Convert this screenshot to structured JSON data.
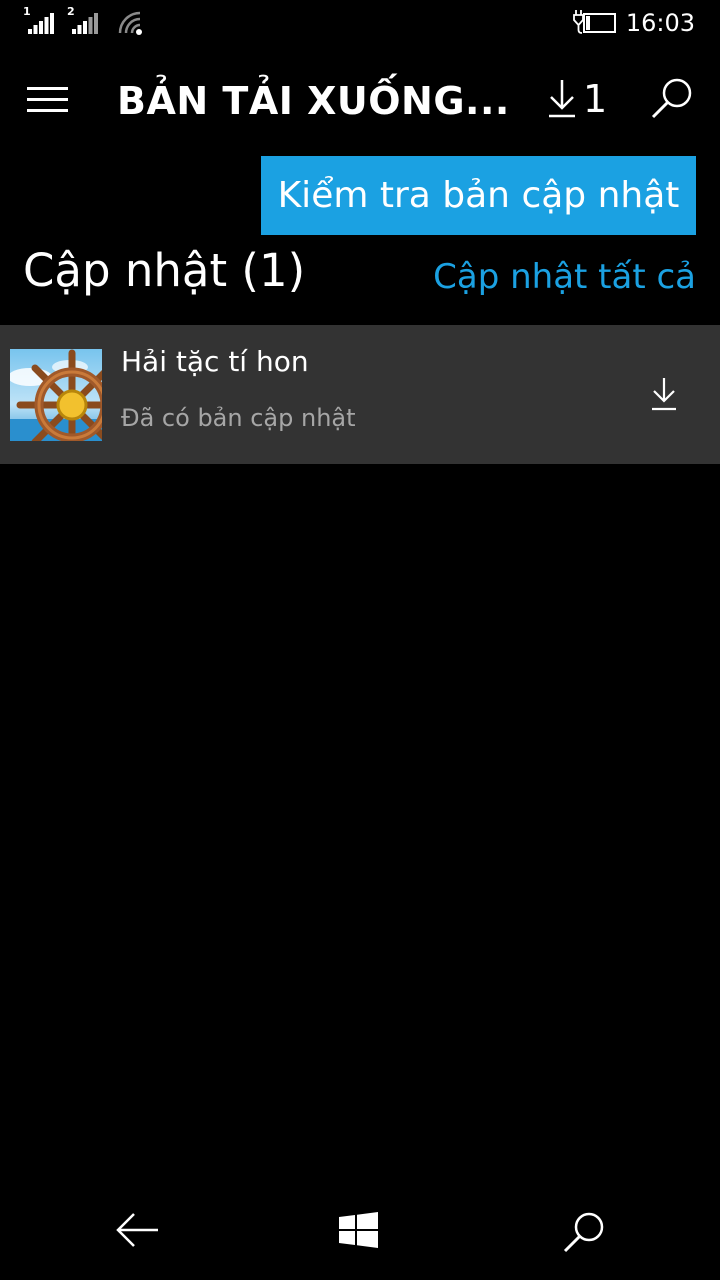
{
  "status_bar": {
    "sim1_label": "1",
    "sim2_label": "2",
    "time": "16:03"
  },
  "header": {
    "menu_icon": "hamburger-menu-icon",
    "title": "BẢN TẢI XUỐNG...",
    "download_icon": "download-arrow-icon",
    "download_count": "1",
    "search_icon": "search-icon"
  },
  "check_updates_button": {
    "label": "Kiểm tra bản cập nhật"
  },
  "updates_section": {
    "title": "Cập nhật (1)",
    "update_all_label": "Cập nhật tất cả",
    "items": [
      {
        "name": "Hải tặc tí hon",
        "status": "Đã có bản cập nhật",
        "icon": "ship-wheel-app-icon",
        "action_icon": "download-arrow-icon"
      }
    ]
  },
  "nav_bar": {
    "back_icon": "back-arrow-icon",
    "home_icon": "windows-logo-icon",
    "search_icon": "search-icon"
  },
  "colors": {
    "background": "#000000",
    "accent": "#1ba1e2",
    "list_item_background": "#333333",
    "secondary_text": "#a6a6a6"
  }
}
